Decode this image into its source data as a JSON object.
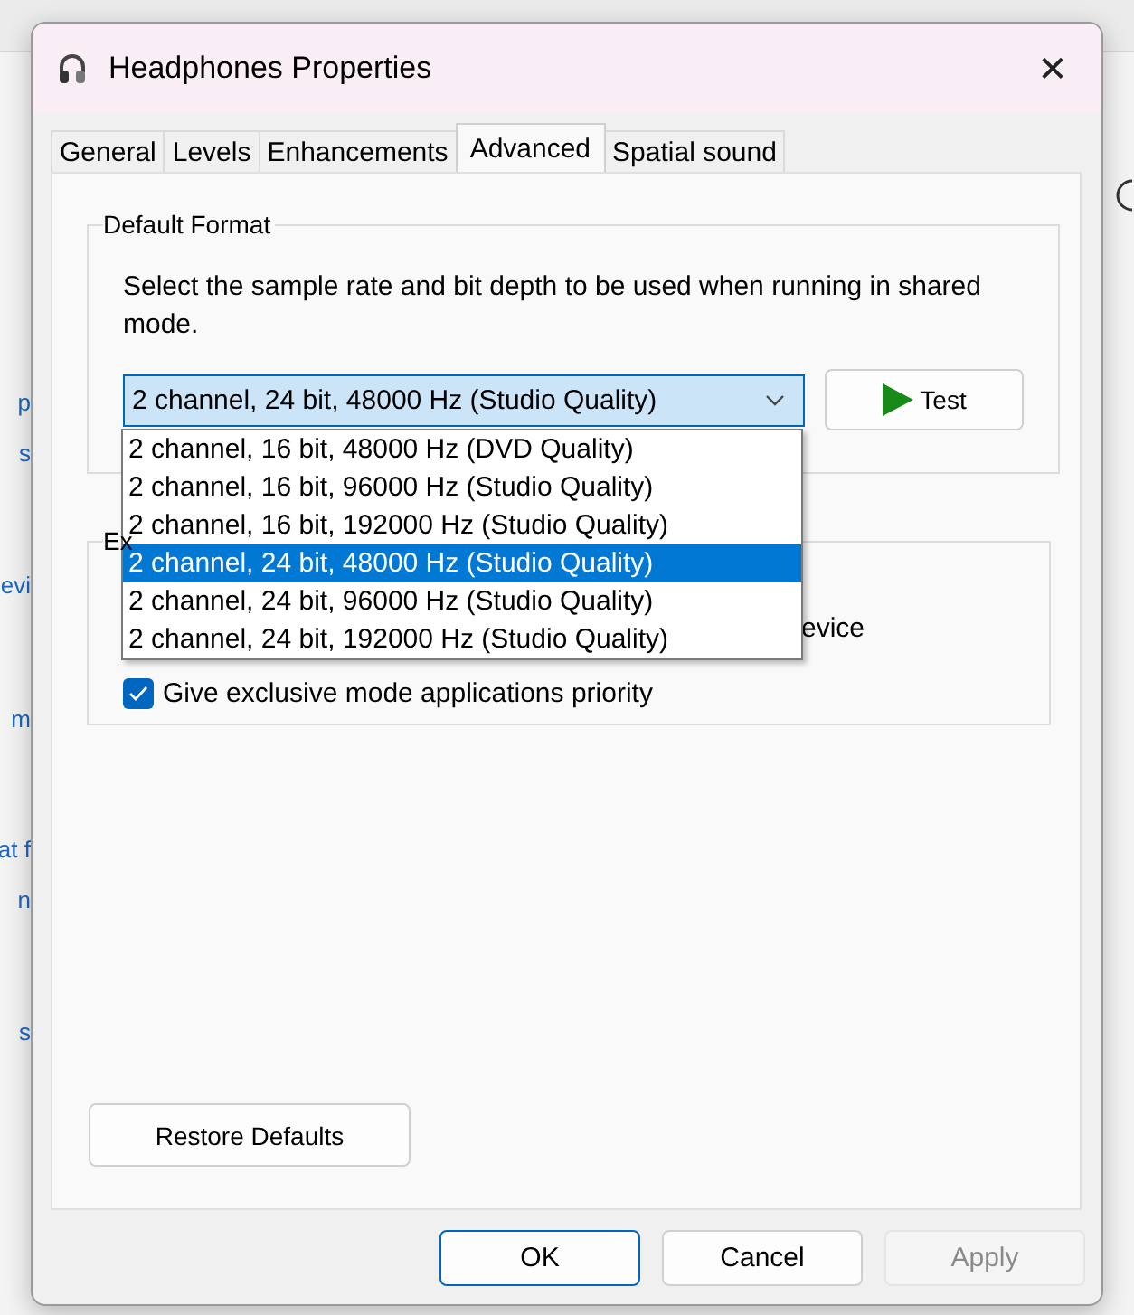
{
  "background_window": {
    "fragments": [
      "p",
      "s",
      "evi",
      "m",
      "at f",
      "n",
      "s"
    ]
  },
  "window": {
    "title": "Headphones Properties",
    "close": "✕"
  },
  "tabs": [
    {
      "label": "General",
      "selected": false
    },
    {
      "label": "Levels",
      "selected": false
    },
    {
      "label": "Enhancements",
      "selected": false
    },
    {
      "label": "Advanced",
      "selected": true
    },
    {
      "label": "Spatial sound",
      "selected": false
    }
  ],
  "default_format": {
    "title": "Default Format",
    "description": "Select the sample rate and bit depth to be used when running in shared mode.",
    "combo": {
      "value": "2 channel, 24 bit, 48000 Hz (Studio Quality)",
      "expanded": true,
      "options": [
        {
          "label": "2 channel, 16 bit, 48000 Hz (DVD Quality)",
          "selected": false
        },
        {
          "label": "2 channel, 16 bit, 96000 Hz (Studio Quality)",
          "selected": false
        },
        {
          "label": "2 channel, 16 bit, 192000 Hz (Studio Quality)",
          "selected": false
        },
        {
          "label": "2 channel, 24 bit, 48000 Hz (Studio Quality)",
          "selected": true
        },
        {
          "label": "2 channel, 24 bit, 96000 Hz (Studio Quality)",
          "selected": false
        },
        {
          "label": "2 channel, 24 bit, 192000 Hz (Studio Quality)",
          "selected": false
        }
      ]
    },
    "test_button": "Test"
  },
  "exclusive_mode": {
    "title": "Ex",
    "hidden_option_tail": "evice",
    "options": [
      {
        "label": "Give exclusive mode applications priority",
        "checked": true
      }
    ]
  },
  "restore_button": "Restore Defaults",
  "buttons": [
    {
      "label": "OK",
      "default": true,
      "disabled": false
    },
    {
      "label": "Cancel",
      "default": false,
      "disabled": false
    },
    {
      "label": "Apply",
      "default": false,
      "disabled": true
    }
  ]
}
